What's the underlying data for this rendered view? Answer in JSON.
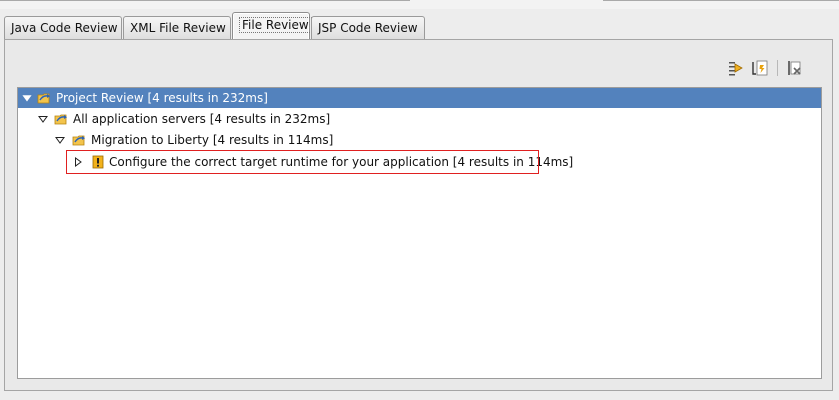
{
  "tabs": [
    {
      "label": "Java Code Review"
    },
    {
      "label": "XML File Review"
    },
    {
      "label": "File Review",
      "active": true
    },
    {
      "label": "JSP Code Review"
    }
  ],
  "toolbar": {
    "buttons": [
      {
        "icon": "run-review-icon"
      },
      {
        "icon": "export-results-icon"
      },
      {
        "icon": "clear-results-icon"
      }
    ]
  },
  "tree": {
    "nodes": [
      {
        "label": "Project Review [4 results in 232ms]",
        "icon": "folder-review-icon",
        "expanded": true,
        "selected": true
      },
      {
        "label": "All application servers [4 results in 232ms]",
        "icon": "folder-review-icon",
        "expanded": true
      },
      {
        "label": "Migration to Liberty [4 results in 114ms]",
        "icon": "folder-review-icon",
        "expanded": true
      },
      {
        "label": "Configure the correct target runtime for your application [4 results in 114ms]",
        "icon": "warning-icon",
        "expanded": false
      }
    ]
  },
  "colors": {
    "selection": "#5382bd",
    "highlight_border": "#e02020",
    "warning": "#e8a20c"
  }
}
